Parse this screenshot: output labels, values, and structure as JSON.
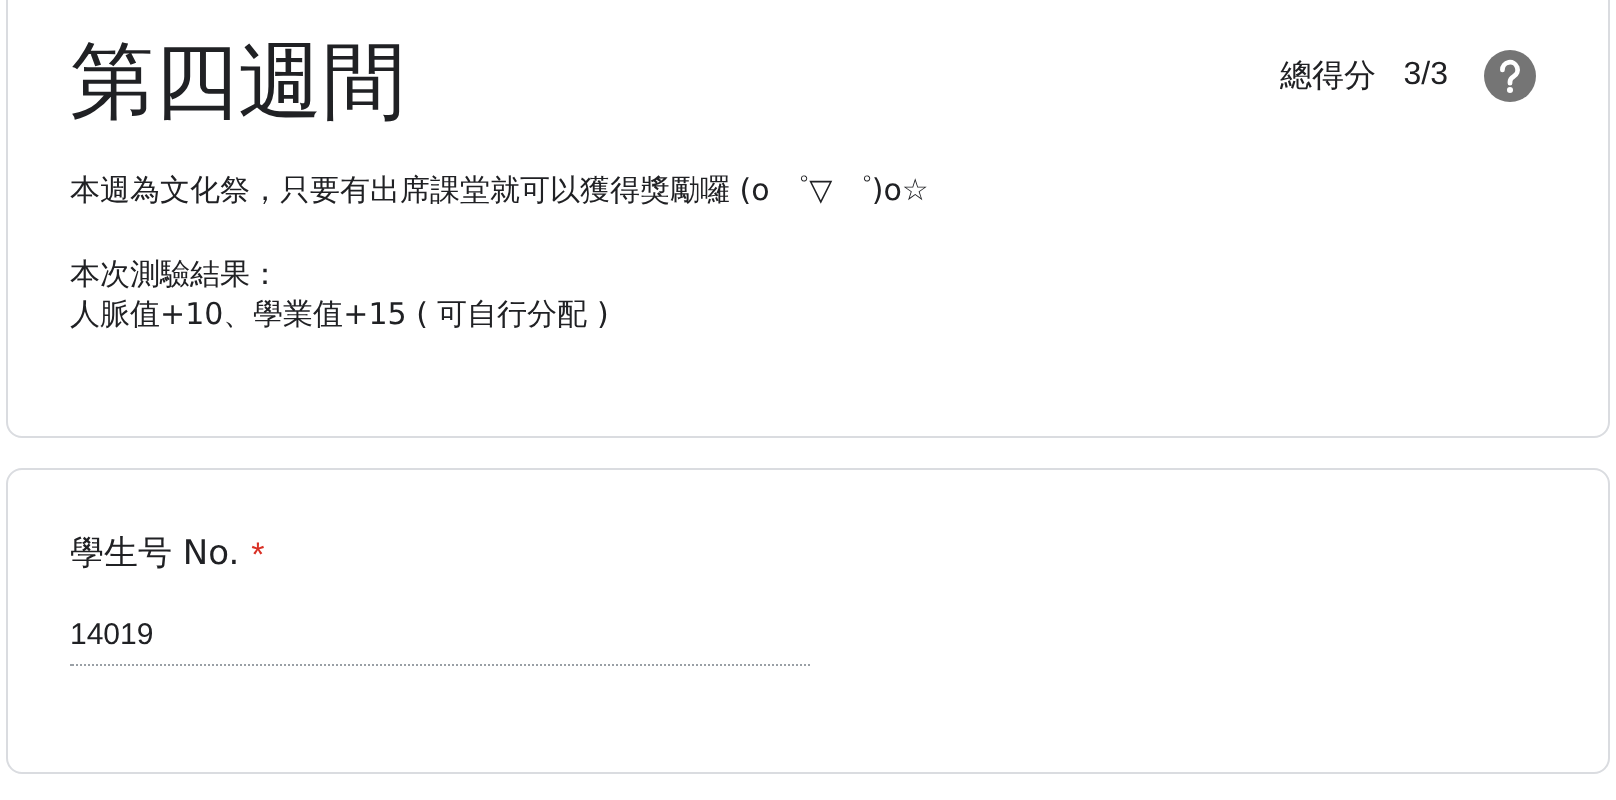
{
  "header": {
    "title": "第四週間",
    "score_label": "總得分",
    "score": "3/3",
    "description": "本週為文化祭，只要有出席課堂就可以獲得獎勵囉 (o ゜▽ ゜)o☆",
    "result_lines": [
      "本次測驗結果：",
      "人脈值+10、學業值+15 ( 可自行分配 )"
    ]
  },
  "question": {
    "label": "學生号 No.",
    "required": true,
    "required_mark": "*",
    "value": "14019"
  }
}
